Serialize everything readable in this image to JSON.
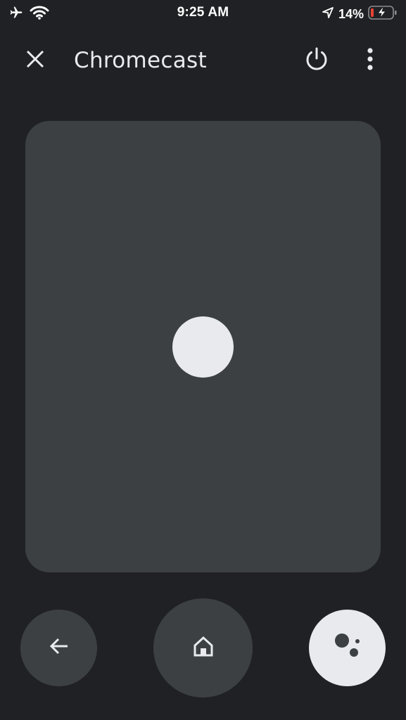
{
  "status_bar": {
    "time": "9:25 AM",
    "battery_percent": "14%",
    "icons": [
      "airplane-icon",
      "wifi-icon",
      "location-arrow-icon",
      "battery-charging-icon"
    ]
  },
  "app_bar": {
    "title": "Chromecast",
    "close_icon": "close-icon",
    "power_icon": "power-icon",
    "more_icon": "more-vert-icon"
  },
  "controls": {
    "back_icon": "arrow-back-icon",
    "home_icon": "home-icon",
    "assistant_icon": "google-assistant-icon"
  },
  "colors": {
    "background": "#202124",
    "surface": "#3c4043",
    "foreground": "#e8eaed",
    "battery_low": "#ea4335"
  }
}
